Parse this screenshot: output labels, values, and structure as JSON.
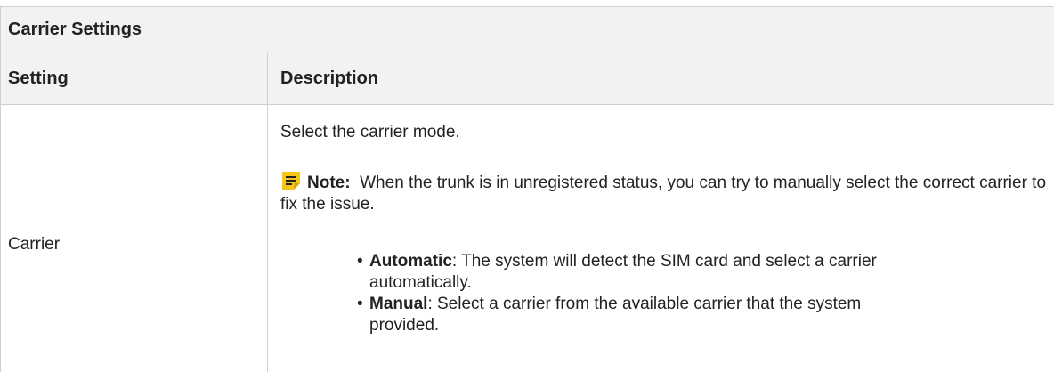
{
  "table": {
    "caption": "Carrier Settings",
    "headers": [
      "Setting",
      "Description"
    ],
    "rows": [
      {
        "setting": "Carrier",
        "description": "Select the carrier mode.",
        "note_label": "Note:",
        "note_text": "When the trunk is in unregistered status, you can try to manually select the correct carrier to fix the issue.",
        "options": [
          {
            "term": "Automatic",
            "text": ": The system will detect the SIM card and select a carrier automatically."
          },
          {
            "term": "Manual",
            "text": ": Select a carrier from the available carrier that the system provided."
          }
        ]
      }
    ]
  },
  "icons": {
    "note": "note-icon"
  },
  "colors": {
    "note_icon": "#f5c518",
    "header_bg": "#f2f2f2"
  }
}
